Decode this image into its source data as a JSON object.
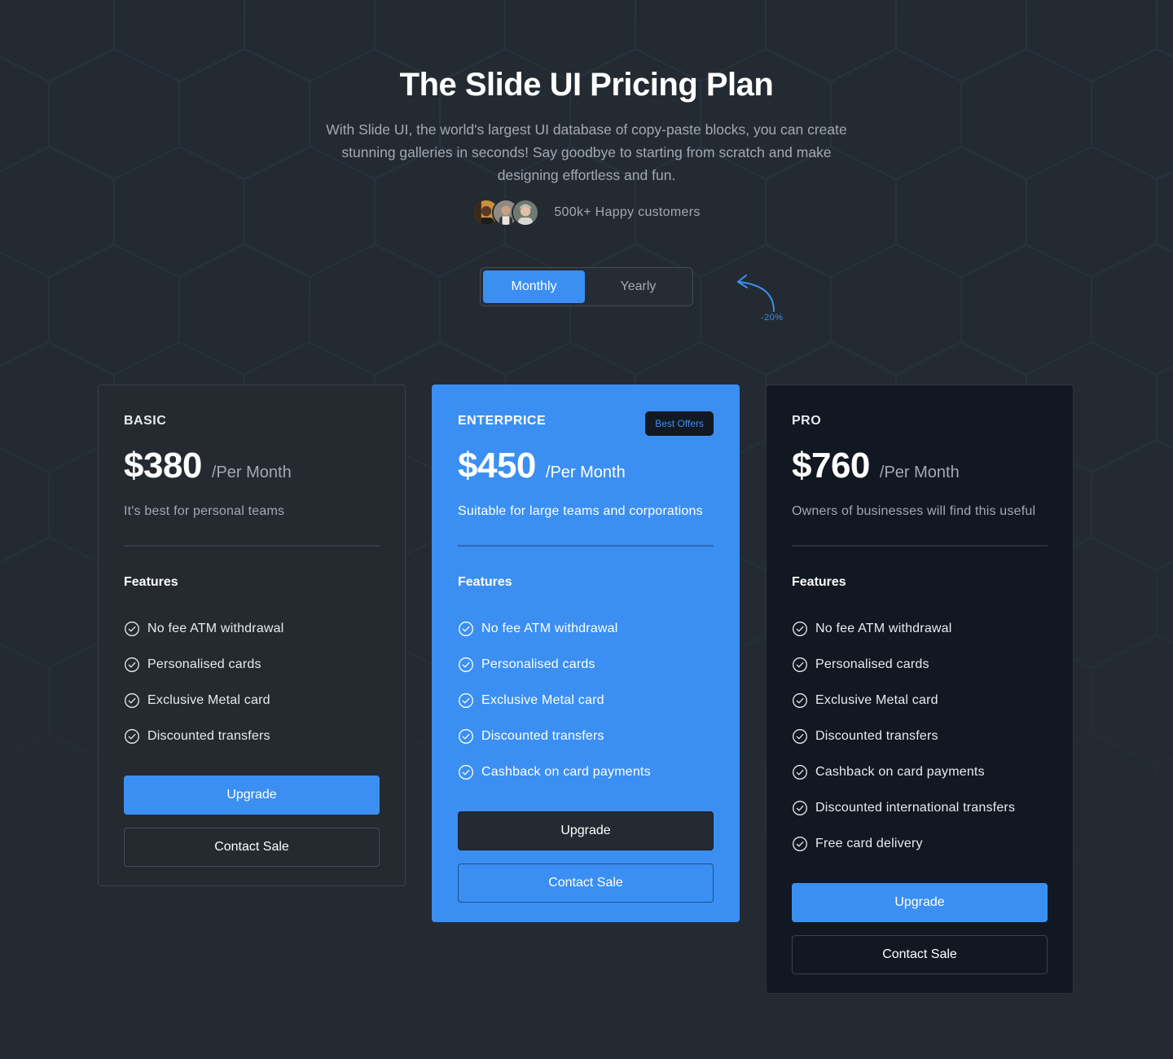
{
  "hero": {
    "title": "The Slide UI Pricing Plan",
    "description": "With Slide UI, the world's largest UI database of copy-paste blocks, you can create stunning galleries in seconds! Say goodbye to starting from scratch and make designing effortless and fun.",
    "customers_text": "500k+ Happy customers"
  },
  "billing": {
    "monthly_label": "Monthly",
    "yearly_label": "Yearly",
    "selected": "Monthly",
    "discount_label": "-20%"
  },
  "plans": [
    {
      "name": "BASIC",
      "price": "$380",
      "period": "/Per Month",
      "description": "It's best for personal teams",
      "features_title": "Features",
      "features": [
        "No fee ATM withdrawal",
        "Personalised cards",
        "Exclusive Metal card",
        "Discounted transfers"
      ],
      "upgrade_label": "Upgrade",
      "contact_label": "Contact Sale"
    },
    {
      "name": "ENTERPRICE",
      "badge": "Best Offers",
      "price": "$450",
      "period": "/Per Month",
      "description": "Suitable for large teams and corporations",
      "features_title": "Features",
      "features": [
        "No fee ATM withdrawal",
        "Personalised cards",
        "Exclusive Metal card",
        "Discounted transfers",
        "Cashback on card payments"
      ],
      "upgrade_label": "Upgrade",
      "contact_label": "Contact Sale"
    },
    {
      "name": "PRO",
      "price": "$760",
      "period": "/Per Month",
      "description": "Owners of businesses will find this useful",
      "features_title": "Features",
      "features": [
        "No fee ATM withdrawal",
        "Personalised cards",
        "Exclusive Metal card",
        "Discounted transfers",
        "Cashback on card payments",
        "Discounted international transfers",
        "Free card delivery"
      ],
      "upgrade_label": "Upgrade",
      "contact_label": "Contact Sale"
    }
  ],
  "colors": {
    "background": "#242a32",
    "accent": "#3b8ff2",
    "pro_card": "#121821",
    "muted_text": "#a3a9b2"
  },
  "icons": {
    "feature": "check-circle-icon",
    "discount": "curved-arrow-icon"
  }
}
